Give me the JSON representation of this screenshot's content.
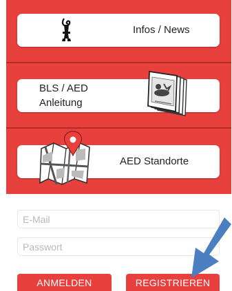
{
  "menu": {
    "infos_label": "Infos / News",
    "bls_label_line1": "BLS / AED",
    "bls_label_line2": "Anleitung",
    "aed_label": "AED Standorte"
  },
  "login": {
    "email_placeholder": "E-Mail",
    "password_placeholder": "Passwort",
    "login_label": "ANMELDEN",
    "register_label": "REGISTRIEREN"
  },
  "colors": {
    "primary_red": "#e8403d",
    "arrow_blue": "#4a7fc1"
  },
  "icons": [
    "basel-crest-icon",
    "manual-booklet-icon",
    "map-pin-icon",
    "arrow-pointer-icon"
  ]
}
